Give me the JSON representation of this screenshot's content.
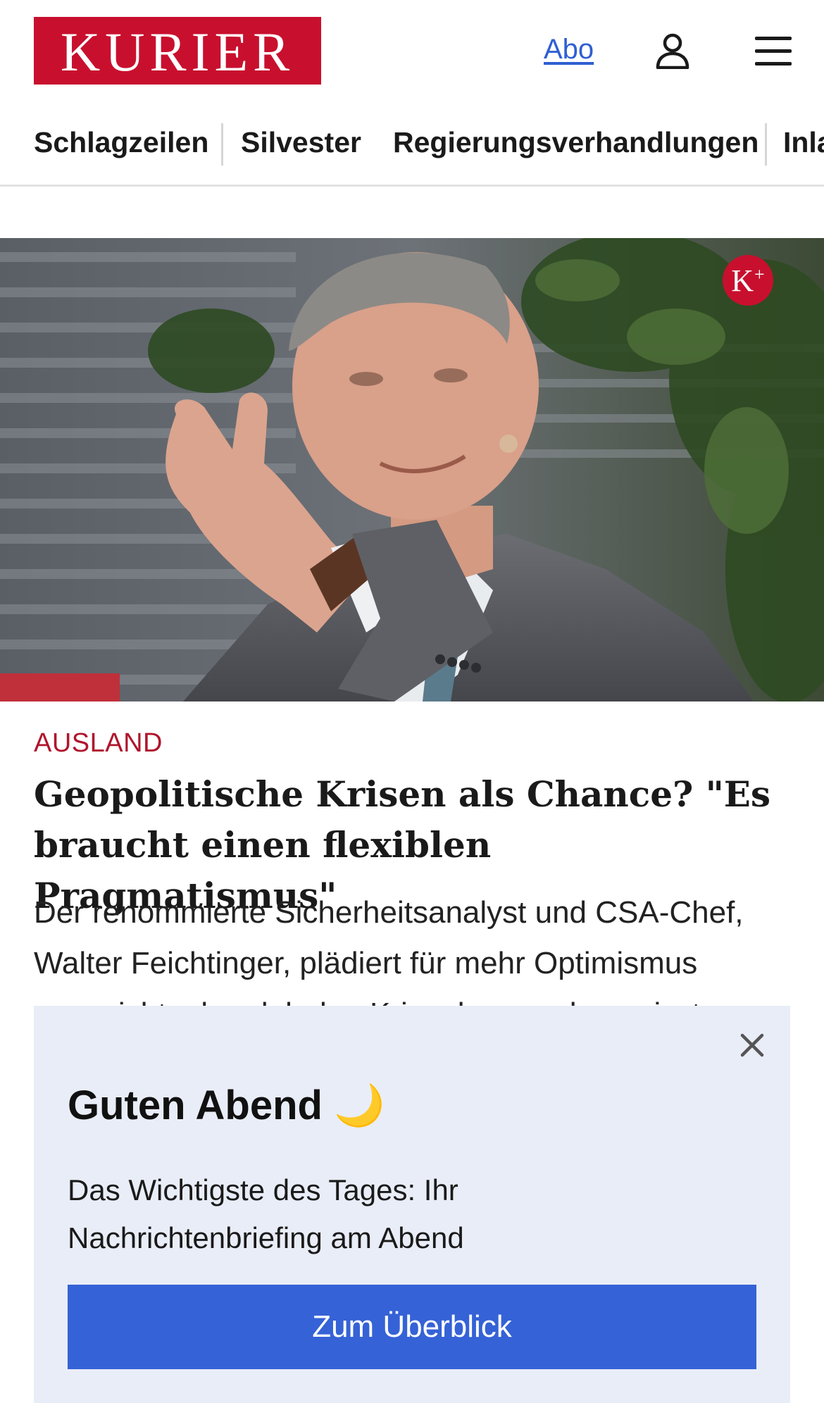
{
  "header": {
    "logo_text": "KURIER",
    "abo_label": "Abo",
    "icons": [
      "user-icon",
      "menu-icon"
    ]
  },
  "nav": {
    "items": [
      {
        "label": "Schlagzeilen"
      },
      {
        "label": "Silvester"
      },
      {
        "label": "Regierungsverhandlungen"
      },
      {
        "label": "Inla"
      }
    ]
  },
  "article": {
    "badge": "K",
    "badge_sup": "+",
    "kicker": "AUSLAND",
    "headline": "Geopolitische Krisen als Chance? \"Es braucht einen flexiblen Pragmatismus\"",
    "teaser": "Der renommierte Sicherheitsanalyst und CSA-Chef, Walter Feichtinger, plädiert für mehr Optimismus angesichts der globalen Krisenlage und vermisst"
  },
  "popup": {
    "title": "Guten Abend 🌙",
    "text": "Das Wichtigste des Tages: Ihr Nachrichtenbriefing am Abend",
    "button_label": "Zum Überblick",
    "close_icon": "close-icon"
  },
  "colors": {
    "brand_red": "#c8102e",
    "kicker_red": "#b0152c",
    "link_blue": "#2f5fd1",
    "cta_blue": "#3562d6",
    "card_bg": "#e9edf7"
  }
}
